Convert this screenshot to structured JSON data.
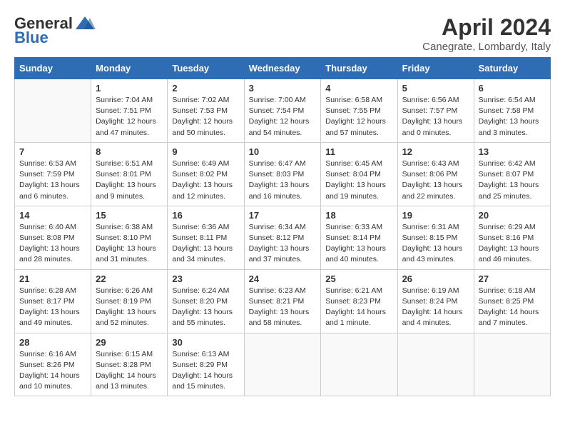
{
  "logo": {
    "general": "General",
    "blue": "Blue"
  },
  "header": {
    "month": "April 2024",
    "location": "Canegrate, Lombardy, Italy"
  },
  "weekdays": [
    "Sunday",
    "Monday",
    "Tuesday",
    "Wednesday",
    "Thursday",
    "Friday",
    "Saturday"
  ],
  "weeks": [
    [
      {
        "day": "",
        "info": ""
      },
      {
        "day": "1",
        "info": "Sunrise: 7:04 AM\nSunset: 7:51 PM\nDaylight: 12 hours\nand 47 minutes."
      },
      {
        "day": "2",
        "info": "Sunrise: 7:02 AM\nSunset: 7:53 PM\nDaylight: 12 hours\nand 50 minutes."
      },
      {
        "day": "3",
        "info": "Sunrise: 7:00 AM\nSunset: 7:54 PM\nDaylight: 12 hours\nand 54 minutes."
      },
      {
        "day": "4",
        "info": "Sunrise: 6:58 AM\nSunset: 7:55 PM\nDaylight: 12 hours\nand 57 minutes."
      },
      {
        "day": "5",
        "info": "Sunrise: 6:56 AM\nSunset: 7:57 PM\nDaylight: 13 hours\nand 0 minutes."
      },
      {
        "day": "6",
        "info": "Sunrise: 6:54 AM\nSunset: 7:58 PM\nDaylight: 13 hours\nand 3 minutes."
      }
    ],
    [
      {
        "day": "7",
        "info": "Sunrise: 6:53 AM\nSunset: 7:59 PM\nDaylight: 13 hours\nand 6 minutes."
      },
      {
        "day": "8",
        "info": "Sunrise: 6:51 AM\nSunset: 8:01 PM\nDaylight: 13 hours\nand 9 minutes."
      },
      {
        "day": "9",
        "info": "Sunrise: 6:49 AM\nSunset: 8:02 PM\nDaylight: 13 hours\nand 12 minutes."
      },
      {
        "day": "10",
        "info": "Sunrise: 6:47 AM\nSunset: 8:03 PM\nDaylight: 13 hours\nand 16 minutes."
      },
      {
        "day": "11",
        "info": "Sunrise: 6:45 AM\nSunset: 8:04 PM\nDaylight: 13 hours\nand 19 minutes."
      },
      {
        "day": "12",
        "info": "Sunrise: 6:43 AM\nSunset: 8:06 PM\nDaylight: 13 hours\nand 22 minutes."
      },
      {
        "day": "13",
        "info": "Sunrise: 6:42 AM\nSunset: 8:07 PM\nDaylight: 13 hours\nand 25 minutes."
      }
    ],
    [
      {
        "day": "14",
        "info": "Sunrise: 6:40 AM\nSunset: 8:08 PM\nDaylight: 13 hours\nand 28 minutes."
      },
      {
        "day": "15",
        "info": "Sunrise: 6:38 AM\nSunset: 8:10 PM\nDaylight: 13 hours\nand 31 minutes."
      },
      {
        "day": "16",
        "info": "Sunrise: 6:36 AM\nSunset: 8:11 PM\nDaylight: 13 hours\nand 34 minutes."
      },
      {
        "day": "17",
        "info": "Sunrise: 6:34 AM\nSunset: 8:12 PM\nDaylight: 13 hours\nand 37 minutes."
      },
      {
        "day": "18",
        "info": "Sunrise: 6:33 AM\nSunset: 8:14 PM\nDaylight: 13 hours\nand 40 minutes."
      },
      {
        "day": "19",
        "info": "Sunrise: 6:31 AM\nSunset: 8:15 PM\nDaylight: 13 hours\nand 43 minutes."
      },
      {
        "day": "20",
        "info": "Sunrise: 6:29 AM\nSunset: 8:16 PM\nDaylight: 13 hours\nand 46 minutes."
      }
    ],
    [
      {
        "day": "21",
        "info": "Sunrise: 6:28 AM\nSunset: 8:17 PM\nDaylight: 13 hours\nand 49 minutes."
      },
      {
        "day": "22",
        "info": "Sunrise: 6:26 AM\nSunset: 8:19 PM\nDaylight: 13 hours\nand 52 minutes."
      },
      {
        "day": "23",
        "info": "Sunrise: 6:24 AM\nSunset: 8:20 PM\nDaylight: 13 hours\nand 55 minutes."
      },
      {
        "day": "24",
        "info": "Sunrise: 6:23 AM\nSunset: 8:21 PM\nDaylight: 13 hours\nand 58 minutes."
      },
      {
        "day": "25",
        "info": "Sunrise: 6:21 AM\nSunset: 8:23 PM\nDaylight: 14 hours\nand 1 minute."
      },
      {
        "day": "26",
        "info": "Sunrise: 6:19 AM\nSunset: 8:24 PM\nDaylight: 14 hours\nand 4 minutes."
      },
      {
        "day": "27",
        "info": "Sunrise: 6:18 AM\nSunset: 8:25 PM\nDaylight: 14 hours\nand 7 minutes."
      }
    ],
    [
      {
        "day": "28",
        "info": "Sunrise: 6:16 AM\nSunset: 8:26 PM\nDaylight: 14 hours\nand 10 minutes."
      },
      {
        "day": "29",
        "info": "Sunrise: 6:15 AM\nSunset: 8:28 PM\nDaylight: 14 hours\nand 13 minutes."
      },
      {
        "day": "30",
        "info": "Sunrise: 6:13 AM\nSunset: 8:29 PM\nDaylight: 14 hours\nand 15 minutes."
      },
      {
        "day": "",
        "info": ""
      },
      {
        "day": "",
        "info": ""
      },
      {
        "day": "",
        "info": ""
      },
      {
        "day": "",
        "info": ""
      }
    ]
  ]
}
